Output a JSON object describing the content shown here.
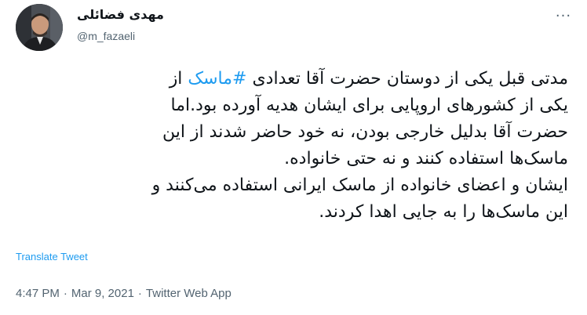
{
  "user": {
    "display_name": "مهدی فضائلی",
    "handle": "@m_fazaeli"
  },
  "tweet": {
    "lines": [
      {
        "before": "مدتی قبل یکی از دوستان حضرت آقا تعدادی ",
        "hashtag": "#ماسک",
        "after": " از"
      },
      {
        "text": "یکی از کشورهای اروپایی برای ایشان هدیه آورده بود.اما"
      },
      {
        "text": "حضرت آقا بدلیل خارجی بودن، نه خود حاضر شدند از این"
      },
      {
        "text": "ماسک‌ها استفاده کنند و نه حتی خانواده."
      },
      {
        "text": "ایشان و اعضای خانواده از ماسک ایرانی استفاده می‌کنند و"
      },
      {
        "text": "این ماسک‌ها را به جایی اهدا کردند."
      }
    ]
  },
  "translate_label": "Translate Tweet",
  "meta": {
    "time": "4:47 PM",
    "separator": "·",
    "date": "Mar 9, 2021",
    "app": "Twitter Web App"
  },
  "more_glyph": "···"
}
